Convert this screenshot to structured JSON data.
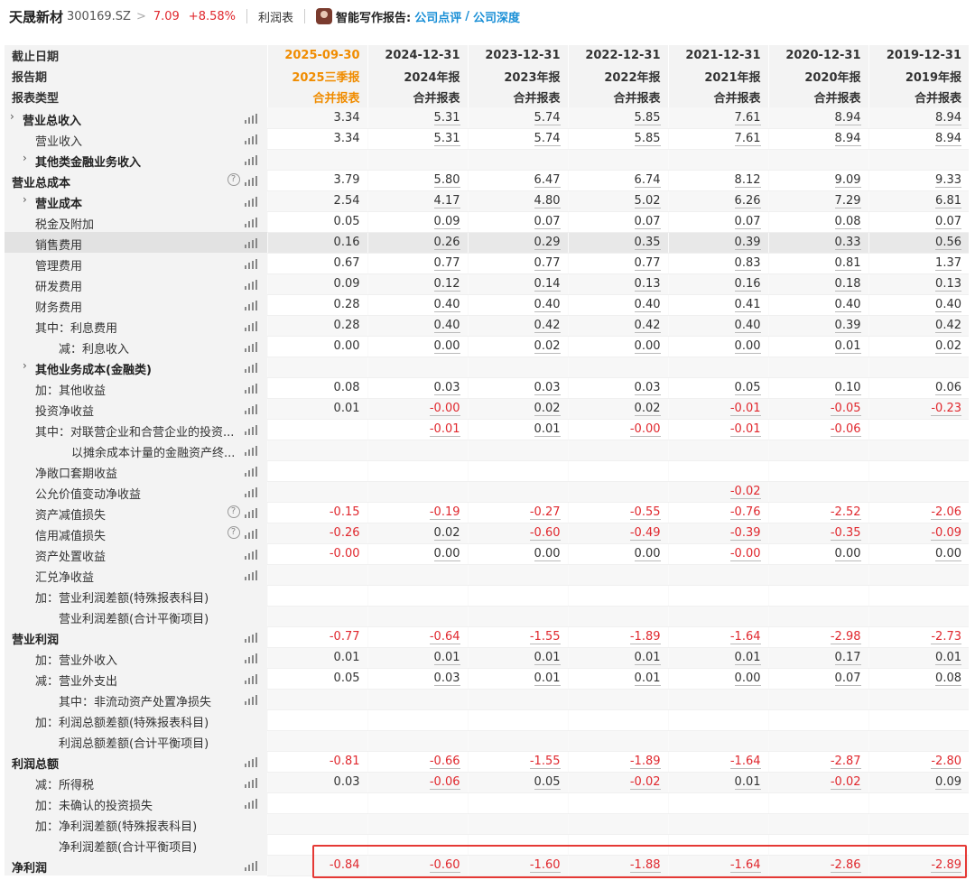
{
  "header": {
    "stock_name": "天晟新材",
    "stock_code": "300169.SZ",
    "chevron": ">",
    "price": "7.09",
    "change_pct": "+8.58%",
    "tab": "利润表",
    "ai_label": "智能写作报告:",
    "link1": "公司点评",
    "slash": "/",
    "link2": "公司深度"
  },
  "table": {
    "header_rows": [
      {
        "label": "截止日期",
        "values": [
          "2025-09-30",
          "2024-12-31",
          "2023-12-31",
          "2022-12-31",
          "2021-12-31",
          "2020-12-31",
          "2019-12-31"
        ]
      },
      {
        "label": "报告期",
        "values": [
          "2025三季报",
          "2024年报",
          "2023年报",
          "2022年报",
          "2021年报",
          "2020年报",
          "2019年报"
        ]
      },
      {
        "label": "报表类型",
        "values": [
          "合并报表",
          "合并报表",
          "合并报表",
          "合并报表",
          "合并报表",
          "合并报表",
          "合并报表"
        ]
      }
    ],
    "rows": [
      {
        "label": "营业总收入",
        "indent": 1,
        "bold": true,
        "arrow": true,
        "help": false,
        "values": [
          "3.34",
          "5.31",
          "5.74",
          "5.85",
          "7.61",
          "8.94",
          "8.94"
        ]
      },
      {
        "label": "营业收入",
        "indent": 2,
        "bold": false,
        "arrow": false,
        "help": false,
        "values": [
          "3.34",
          "5.31",
          "5.74",
          "5.85",
          "7.61",
          "8.94",
          "8.94"
        ]
      },
      {
        "label": "其他类金融业务收入",
        "indent": 2,
        "bold": true,
        "arrow": true,
        "help": false,
        "values": [
          "",
          "",
          "",
          "",
          "",
          "",
          ""
        ]
      },
      {
        "label": "营业总成本",
        "indent": 0,
        "bold": true,
        "arrow": false,
        "help": true,
        "values": [
          "3.79",
          "5.80",
          "6.47",
          "6.74",
          "8.12",
          "9.09",
          "9.33"
        ]
      },
      {
        "label": "营业成本",
        "indent": 2,
        "bold": true,
        "arrow": true,
        "help": false,
        "values": [
          "2.54",
          "4.17",
          "4.80",
          "5.02",
          "6.26",
          "7.29",
          "6.81"
        ]
      },
      {
        "label": "税金及附加",
        "indent": 2,
        "bold": false,
        "arrow": false,
        "help": false,
        "values": [
          "0.05",
          "0.09",
          "0.07",
          "0.07",
          "0.07",
          "0.08",
          "0.07"
        ]
      },
      {
        "label": "销售费用",
        "indent": 2,
        "bold": false,
        "arrow": false,
        "help": false,
        "highlight": true,
        "values": [
          "0.16",
          "0.26",
          "0.29",
          "0.35",
          "0.39",
          "0.33",
          "0.56"
        ]
      },
      {
        "label": "管理费用",
        "indent": 2,
        "bold": false,
        "arrow": false,
        "help": false,
        "values": [
          "0.67",
          "0.77",
          "0.77",
          "0.77",
          "0.83",
          "0.81",
          "1.37"
        ]
      },
      {
        "label": "研发费用",
        "indent": 2,
        "bold": false,
        "arrow": false,
        "help": false,
        "values": [
          "0.09",
          "0.12",
          "0.14",
          "0.13",
          "0.16",
          "0.18",
          "0.13"
        ]
      },
      {
        "label": "财务费用",
        "indent": 2,
        "bold": false,
        "arrow": false,
        "help": false,
        "values": [
          "0.28",
          "0.40",
          "0.40",
          "0.40",
          "0.41",
          "0.40",
          "0.40"
        ]
      },
      {
        "label": "其中：利息费用",
        "indent": 2,
        "bold": false,
        "arrow": false,
        "help": false,
        "values": [
          "0.28",
          "0.40",
          "0.42",
          "0.42",
          "0.40",
          "0.39",
          "0.42"
        ]
      },
      {
        "label": "减：利息收入",
        "indent": 4,
        "bold": false,
        "arrow": false,
        "help": false,
        "values": [
          "0.00",
          "0.00",
          "0.02",
          "0.00",
          "0.00",
          "0.01",
          "0.02"
        ]
      },
      {
        "label": "其他业务成本(金融类)",
        "indent": 2,
        "bold": true,
        "arrow": true,
        "help": false,
        "values": [
          "",
          "",
          "",
          "",
          "",
          "",
          ""
        ]
      },
      {
        "label": "加：其他收益",
        "indent": 2,
        "bold": false,
        "arrow": false,
        "help": false,
        "values": [
          "0.08",
          "0.03",
          "0.03",
          "0.03",
          "0.05",
          "0.10",
          "0.06"
        ]
      },
      {
        "label": "投资净收益",
        "indent": 2,
        "bold": false,
        "arrow": false,
        "help": false,
        "values": [
          "0.01",
          "-0.00",
          "0.02",
          "0.02",
          "-0.01",
          "-0.05",
          "-0.23"
        ]
      },
      {
        "label": "其中：对联营企业和合营企业的投资...",
        "indent": 2,
        "bold": false,
        "arrow": false,
        "help": false,
        "values": [
          "",
          "-0.01",
          "0.01",
          "-0.00",
          "-0.01",
          "-0.06",
          ""
        ]
      },
      {
        "label": "以摊余成本计量的金融资产终...",
        "indent": 5,
        "bold": false,
        "arrow": false,
        "help": false,
        "values": [
          "",
          "",
          "",
          "",
          "",
          "",
          ""
        ]
      },
      {
        "label": "净敞口套期收益",
        "indent": 2,
        "bold": false,
        "arrow": false,
        "help": false,
        "values": [
          "",
          "",
          "",
          "",
          "",
          "",
          ""
        ]
      },
      {
        "label": "公允价值变动净收益",
        "indent": 2,
        "bold": false,
        "arrow": false,
        "help": false,
        "values": [
          "",
          "",
          "",
          "",
          "-0.02",
          "",
          ""
        ]
      },
      {
        "label": "资产减值损失",
        "indent": 2,
        "bold": false,
        "arrow": false,
        "help": true,
        "values": [
          "-0.15",
          "-0.19",
          "-0.27",
          "-0.55",
          "-0.76",
          "-2.52",
          "-2.06"
        ]
      },
      {
        "label": "信用减值损失",
        "indent": 2,
        "bold": false,
        "arrow": false,
        "help": true,
        "values": [
          "-0.26",
          "0.02",
          "-0.60",
          "-0.49",
          "-0.39",
          "-0.35",
          "-0.09"
        ]
      },
      {
        "label": "资产处置收益",
        "indent": 2,
        "bold": false,
        "arrow": false,
        "help": false,
        "values": [
          "-0.00",
          "0.00",
          "0.00",
          "0.00",
          "-0.00",
          "0.00",
          "0.00"
        ]
      },
      {
        "label": "汇兑净收益",
        "indent": 2,
        "bold": false,
        "arrow": false,
        "help": false,
        "values": [
          "",
          "",
          "",
          "",
          "",
          "",
          ""
        ]
      },
      {
        "label": "加：营业利润差额(特殊报表科目)",
        "indent": 2,
        "bold": false,
        "arrow": false,
        "help": false,
        "nobar": true,
        "values": [
          "",
          "",
          "",
          "",
          "",
          "",
          ""
        ]
      },
      {
        "label": "营业利润差额(合计平衡项目)",
        "indent": 4,
        "bold": false,
        "arrow": false,
        "help": false,
        "nobar": true,
        "values": [
          "",
          "",
          "",
          "",
          "",
          "",
          ""
        ]
      },
      {
        "label": "营业利润",
        "indent": 0,
        "bold": true,
        "arrow": false,
        "help": false,
        "values": [
          "-0.77",
          "-0.64",
          "-1.55",
          "-1.89",
          "-1.64",
          "-2.98",
          "-2.73"
        ]
      },
      {
        "label": "加：营业外收入",
        "indent": 2,
        "bold": false,
        "arrow": false,
        "help": false,
        "values": [
          "0.01",
          "0.01",
          "0.01",
          "0.01",
          "0.01",
          "0.17",
          "0.01"
        ]
      },
      {
        "label": "减：营业外支出",
        "indent": 2,
        "bold": false,
        "arrow": false,
        "help": false,
        "values": [
          "0.05",
          "0.03",
          "0.01",
          "0.01",
          "0.00",
          "0.07",
          "0.08"
        ]
      },
      {
        "label": "其中：非流动资产处置净损失",
        "indent": 4,
        "bold": false,
        "arrow": false,
        "help": false,
        "values": [
          "",
          "",
          "",
          "",
          "",
          "",
          ""
        ]
      },
      {
        "label": "加：利润总额差额(特殊报表科目)",
        "indent": 2,
        "bold": false,
        "arrow": false,
        "help": false,
        "nobar": true,
        "values": [
          "",
          "",
          "",
          "",
          "",
          "",
          ""
        ]
      },
      {
        "label": "利润总额差额(合计平衡项目)",
        "indent": 4,
        "bold": false,
        "arrow": false,
        "help": false,
        "nobar": true,
        "values": [
          "",
          "",
          "",
          "",
          "",
          "",
          ""
        ]
      },
      {
        "label": "利润总额",
        "indent": 0,
        "bold": true,
        "arrow": false,
        "help": false,
        "values": [
          "-0.81",
          "-0.66",
          "-1.55",
          "-1.89",
          "-1.64",
          "-2.87",
          "-2.80"
        ]
      },
      {
        "label": "减：所得税",
        "indent": 2,
        "bold": false,
        "arrow": false,
        "help": false,
        "values": [
          "0.03",
          "-0.06",
          "0.05",
          "-0.02",
          "0.01",
          "-0.02",
          "0.09"
        ]
      },
      {
        "label": "加：未确认的投资损失",
        "indent": 2,
        "bold": false,
        "arrow": false,
        "help": false,
        "values": [
          "",
          "",
          "",
          "",
          "",
          "",
          ""
        ]
      },
      {
        "label": "加：净利润差额(特殊报表科目)",
        "indent": 2,
        "bold": false,
        "arrow": false,
        "help": false,
        "nobar": true,
        "values": [
          "",
          "",
          "",
          "",
          "",
          "",
          ""
        ]
      },
      {
        "label": "净利润差额(合计平衡项目)",
        "indent": 4,
        "bold": false,
        "arrow": false,
        "help": false,
        "nobar": true,
        "values": [
          "",
          "",
          "",
          "",
          "",
          "",
          ""
        ]
      },
      {
        "label": "净利润",
        "indent": 0,
        "bold": true,
        "arrow": false,
        "help": false,
        "values": [
          "-0.84",
          "-0.60",
          "-1.60",
          "-1.88",
          "-1.64",
          "-2.86",
          "-2.89"
        ]
      }
    ]
  },
  "colors": {
    "negative": "#e0282e",
    "current_period": "#f08c00",
    "link": "#1a8fd6",
    "highlight_box": "#e53935"
  },
  "icons": {
    "row_chart": "bar-chart-icon",
    "row_help": "help-circle-icon",
    "row_expand": "chevron-right-icon"
  }
}
